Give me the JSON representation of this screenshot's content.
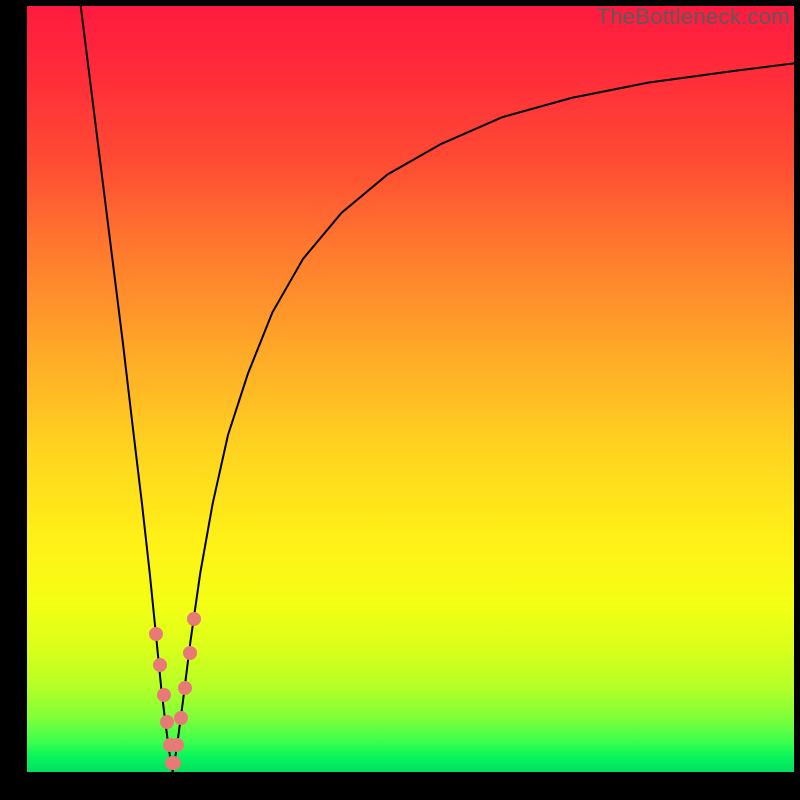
{
  "watermark": "TheBottleneck.com",
  "colors": {
    "gradient_top": "#ff1a3f",
    "gradient_bottom": "#00e060",
    "curve": "#000000",
    "dot": "#e77a77",
    "frame": "#000000"
  },
  "chart_data": {
    "type": "line",
    "title": "",
    "xlabel": "",
    "ylabel": "",
    "xlim": [
      0,
      100
    ],
    "ylim": [
      0,
      100
    ],
    "grid": false,
    "series": [
      {
        "name": "left-branch",
        "x": [
          7.0,
          8.0,
          9.5,
          11.0,
          12.5,
          13.8,
          15.0,
          16.0,
          16.8,
          17.5,
          18.1,
          18.5,
          18.8,
          19.0
        ],
        "y": [
          100.0,
          92.0,
          80.0,
          68.0,
          56.0,
          45.0,
          35.0,
          26.0,
          18.0,
          11.0,
          6.0,
          3.0,
          1.0,
          0.0
        ]
      },
      {
        "name": "right-branch",
        "x": [
          19.0,
          19.5,
          20.3,
          21.3,
          22.6,
          24.2,
          26.2,
          28.8,
          32.0,
          36.0,
          41.0,
          47.0,
          54.0,
          62.0,
          71.0,
          81.0,
          92.0,
          100.0
        ],
        "y": [
          0.0,
          3.0,
          9.0,
          17.0,
          26.0,
          35.0,
          44.0,
          52.0,
          60.0,
          67.0,
          73.0,
          78.0,
          82.0,
          85.5,
          88.0,
          90.0,
          91.5,
          92.5
        ]
      }
    ],
    "scatter": {
      "name": "sweet-spot-band",
      "x": [
        16.8,
        17.3,
        17.8,
        18.2,
        18.6,
        18.9,
        19.2,
        19.6,
        20.1,
        20.6,
        21.2,
        21.8
      ],
      "y": [
        18.0,
        14.0,
        10.0,
        6.5,
        3.5,
        1.2,
        1.2,
        3.5,
        7.0,
        11.0,
        15.5,
        20.0
      ]
    }
  }
}
